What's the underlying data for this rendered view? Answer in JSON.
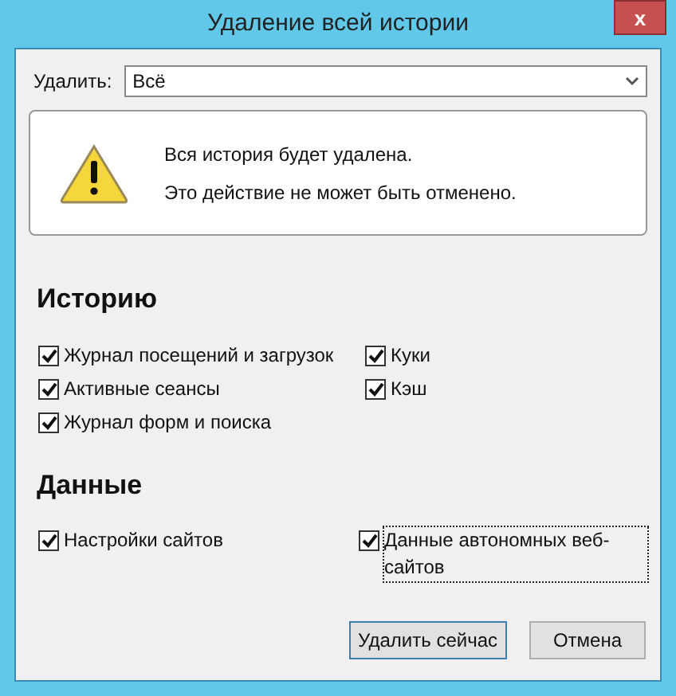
{
  "window": {
    "title": "Удаление всей истории",
    "close": "x"
  },
  "range": {
    "label": "Удалить:",
    "value": "Всё"
  },
  "warning": {
    "lines": [
      "Вся история будет удалена.",
      "Это действие не может быть отменено."
    ]
  },
  "sections": [
    {
      "title": "Историю",
      "columns": [
        [
          {
            "label": "Журнал посещений и загрузок",
            "checked": true,
            "focused": false
          },
          {
            "label": "Активные сеансы",
            "checked": true,
            "focused": false
          },
          {
            "label": "Журнал форм и поиска",
            "checked": true,
            "focused": false
          }
        ],
        [
          {
            "label": "Куки",
            "checked": true,
            "focused": false
          },
          {
            "label": "Кэш",
            "checked": true,
            "focused": false
          }
        ]
      ]
    },
    {
      "title": "Данные",
      "columns": [
        [
          {
            "label": "Настройки сайтов",
            "checked": true,
            "focused": false
          }
        ],
        [
          {
            "label": "Данные автономных веб-сайтов",
            "checked": true,
            "focused": true
          }
        ]
      ]
    }
  ],
  "buttons": [
    {
      "label": "Удалить сейчас",
      "default": true
    },
    {
      "label": "Отмена",
      "default": false
    }
  ]
}
